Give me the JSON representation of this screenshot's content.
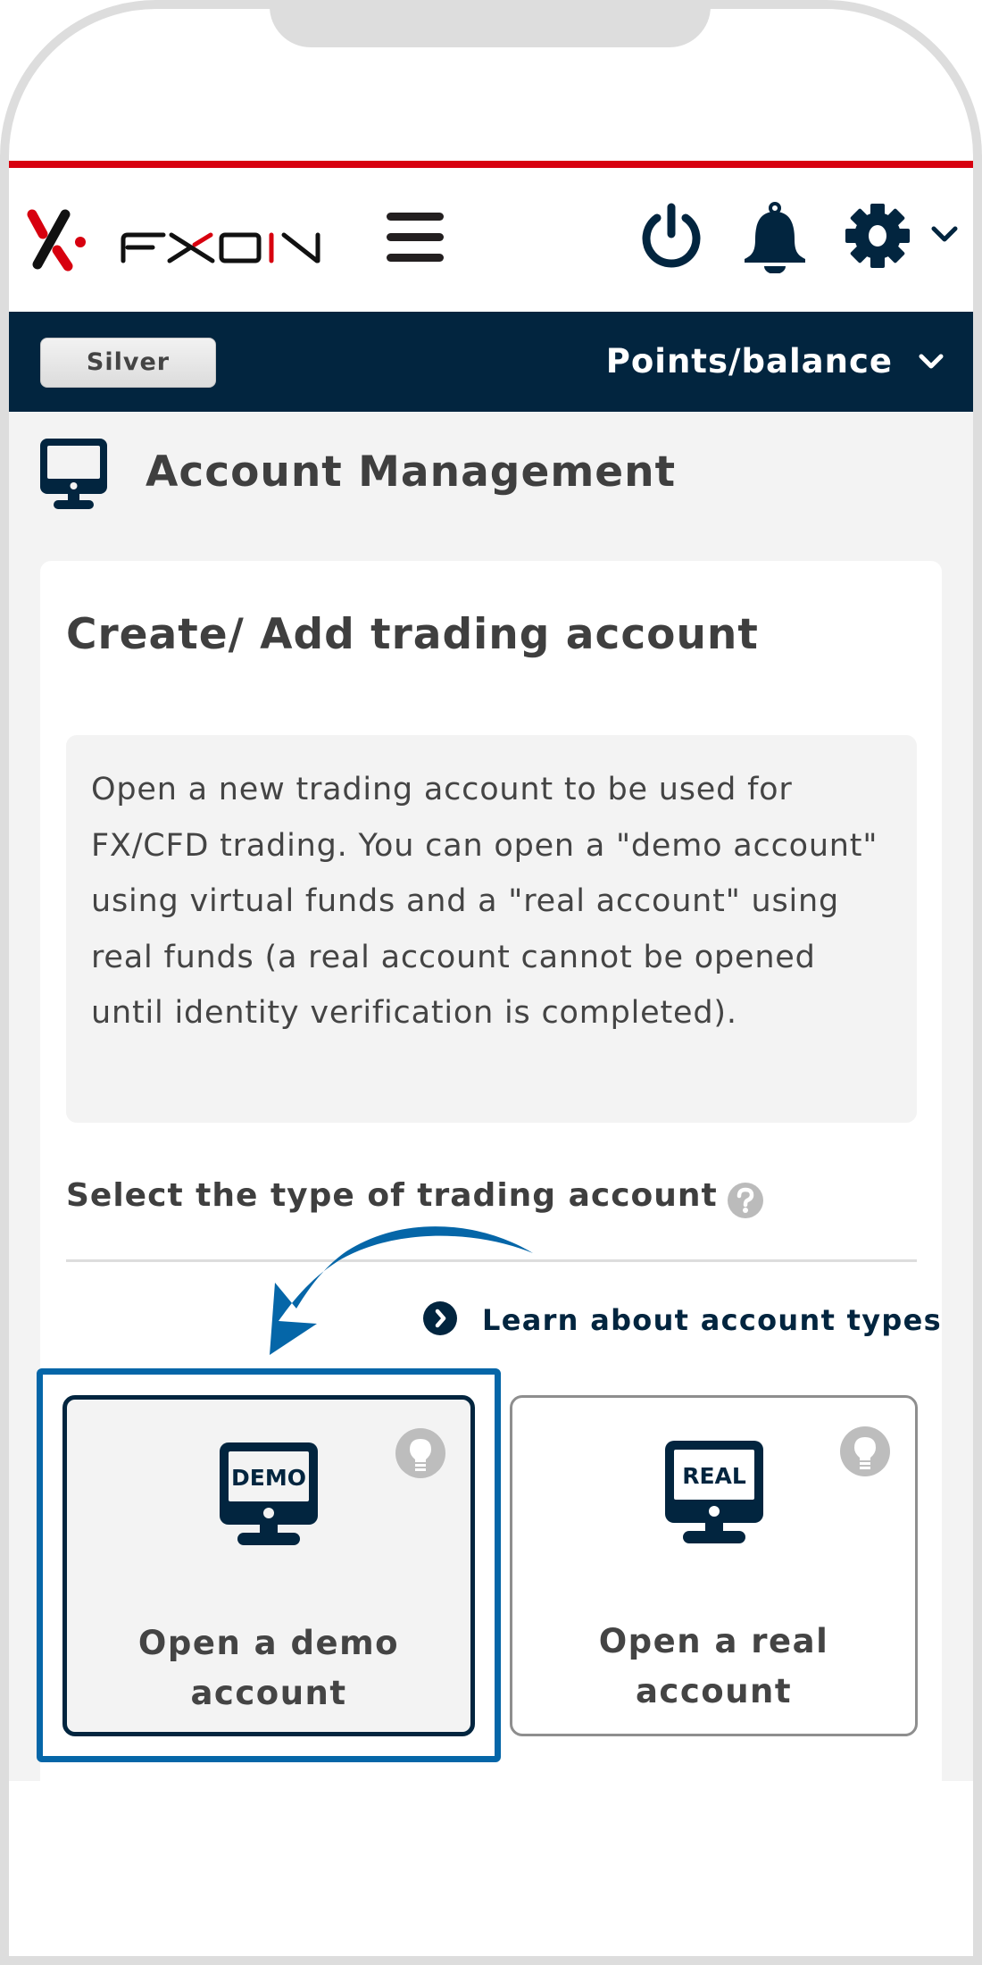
{
  "header": {
    "brand": "FXON",
    "menu_icon": "hamburger-icon",
    "icons": [
      "power-icon",
      "bell-icon",
      "gear-icon",
      "chevron-down-icon"
    ]
  },
  "status_bar": {
    "rank": "Silver",
    "points_label": "Points/balance",
    "points_icon": "chevron-down-icon"
  },
  "page": {
    "icon": "monitor-icon",
    "title": "Account Management"
  },
  "card": {
    "title": "Create/ Add trading account",
    "description": "Open a new trading account to be used for FX/CFD trading. You can open a \"demo account\" using virtual funds and a \"real account\" using real funds (a real account cannot be opened until identity verification is completed).",
    "section_label": "Select the type of trading account",
    "help_icon": "question-circle-icon",
    "learn_link": "Learn about account types",
    "account_types": [
      {
        "screen_text": "DEMO",
        "label_line1": "Open a demo",
        "label_line2": "account",
        "selected": true
      },
      {
        "screen_text": "REAL",
        "label_line1": "Open a real",
        "label_line2": "account",
        "selected": false
      }
    ]
  },
  "colors": {
    "brand_red": "#d7000f",
    "navy": "#02253f",
    "highlight_blue": "#0566a8",
    "page_bg": "#f3f3f3"
  }
}
